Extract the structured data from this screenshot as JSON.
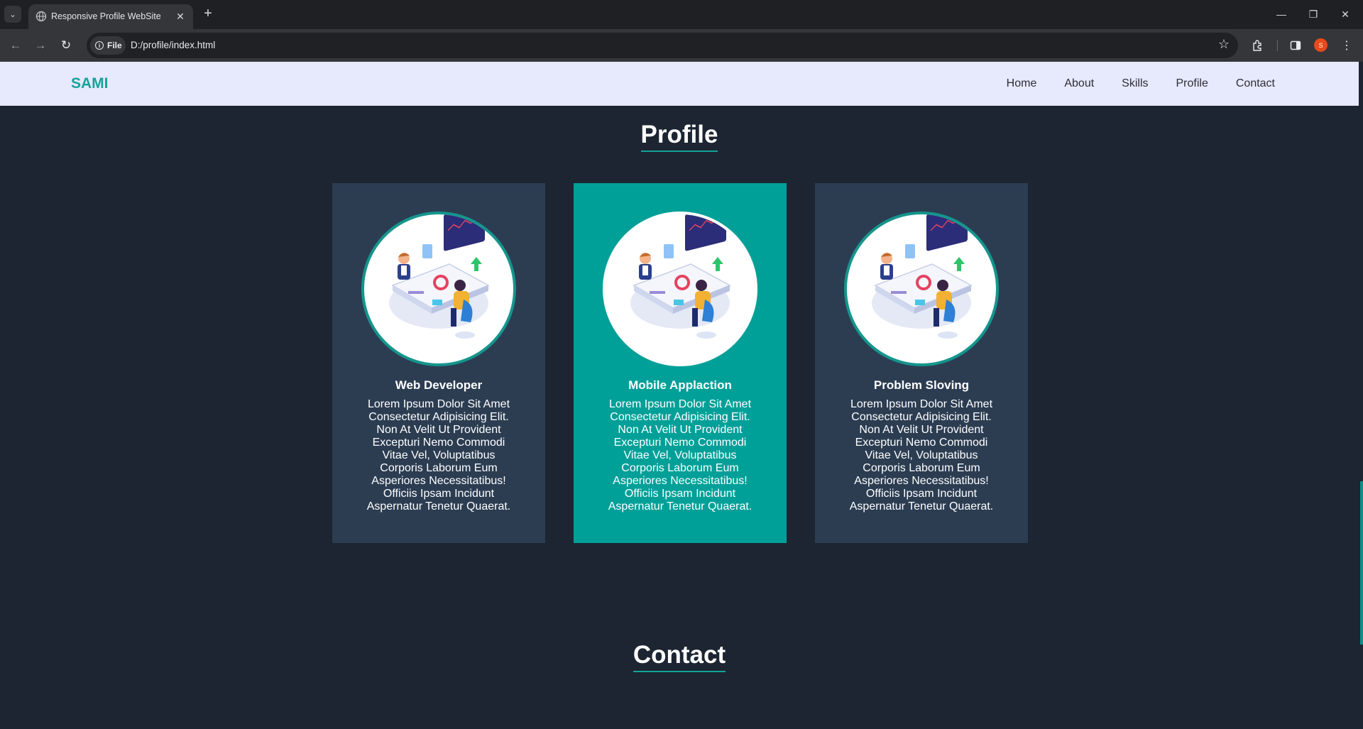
{
  "browser": {
    "tab_title": "Responsive Profile WebSite",
    "chip_label": "File",
    "url": "D:/profile/index.html",
    "profile_initial": "S"
  },
  "site": {
    "logo": "SAMI",
    "nav": [
      "Home",
      "About",
      "Skills",
      "Profile",
      "Contact"
    ]
  },
  "profile_section": {
    "title": "Profile",
    "cards": [
      {
        "title": "Web Developer",
        "text": "Lorem Ipsum Dolor Sit Amet Consectetur Adipisicing Elit. Non At Velit Ut Provident Excepturi Nemo Commodi Vitae Vel, Voluptatibus Corporis Laborum Eum Asperiores Necessitatibus! Officiis Ipsam Incidunt Aspernatur Tenetur Quaerat."
      },
      {
        "title": "Mobile Applaction",
        "text": "Lorem Ipsum Dolor Sit Amet Consectetur Adipisicing Elit. Non At Velit Ut Provident Excepturi Nemo Commodi Vitae Vel, Voluptatibus Corporis Laborum Eum Asperiores Necessitatibus! Officiis Ipsam Incidunt Aspernatur Tenetur Quaerat."
      },
      {
        "title": "Problem Sloving",
        "text": "Lorem Ipsum Dolor Sit Amet Consectetur Adipisicing Elit. Non At Velit Ut Provident Excepturi Nemo Commodi Vitae Vel, Voluptatibus Corporis Laborum Eum Asperiores Necessitatibus! Officiis Ipsam Incidunt Aspernatur Tenetur Quaerat."
      }
    ]
  },
  "contact_section": {
    "title": "Contact"
  },
  "colors": {
    "accent": "#00a098",
    "background": "#1c2531",
    "card": "#2c3d52",
    "header": "#e7e9fc"
  }
}
